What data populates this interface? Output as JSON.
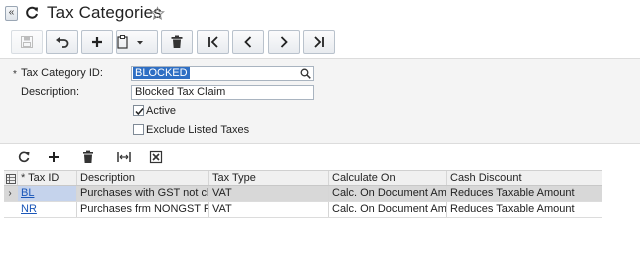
{
  "header": {
    "collapse_glyph": "«",
    "title": "Tax Categories"
  },
  "toolbar": {
    "buttons": [
      {
        "name": "save-button",
        "icon": "save-icon"
      },
      {
        "name": "cancel-button",
        "icon": "undo-icon"
      },
      {
        "name": "add-new-button",
        "icon": "plus-icon"
      },
      {
        "name": "copy-paste-button",
        "icon": "clipboard-icon"
      },
      {
        "name": "delete-button",
        "icon": "trash-icon"
      },
      {
        "name": "first-record-button",
        "icon": "first-icon"
      },
      {
        "name": "previous-record-button",
        "icon": "prev-icon"
      },
      {
        "name": "next-record-button",
        "icon": "next-icon"
      },
      {
        "name": "last-record-button",
        "icon": "last-icon"
      }
    ]
  },
  "form": {
    "required_marker": "*",
    "tax_category_label": "Tax Category ID:",
    "tax_category_value": "BLOCKED",
    "description_label": "Description:",
    "description_value": "Blocked Tax Claim",
    "active_label": "Active",
    "active_checked": true,
    "exclude_label": "Exclude Listed Taxes",
    "exclude_checked": false
  },
  "grid": {
    "columns": [
      {
        "key": "tax_id",
        "label": "Tax ID",
        "required": true
      },
      {
        "key": "description",
        "label": "Description"
      },
      {
        "key": "tax_type",
        "label": "Tax Type"
      },
      {
        "key": "calculate_on",
        "label": "Calculate On"
      },
      {
        "key": "cash_discount",
        "label": "Cash Discount"
      }
    ],
    "required_marker": "*",
    "selected_row_marker": "›",
    "rows": [
      {
        "tax_id": "BL",
        "description": "Purchases with GST not clai...",
        "tax_type": "VAT",
        "calculate_on": "Calc. On Document Amount",
        "cash_discount": "Reduces Taxable Amount"
      },
      {
        "tax_id": "NR",
        "description": "Purchases frm NONGST Reg...",
        "tax_type": "VAT",
        "calculate_on": "Calc. On Document Amount",
        "cash_discount": "Reduces Taxable Amount"
      }
    ]
  },
  "colors": {
    "accent": "#2f6fc4",
    "link": "#1a56b8",
    "selected_row": "#d8d8d8"
  }
}
